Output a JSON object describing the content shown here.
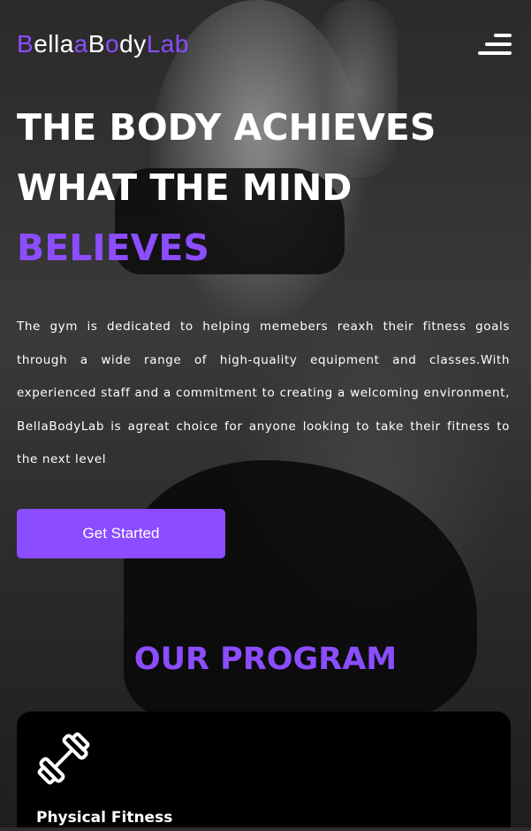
{
  "brand": {
    "logo_parts": [
      {
        "text": "B",
        "accent": true
      },
      {
        "text": "ella",
        "accent": false
      },
      {
        "text": "a",
        "accent": true
      },
      {
        "text": "B",
        "accent": false
      },
      {
        "text": "o",
        "accent": true
      },
      {
        "text": "dy",
        "accent": false
      },
      {
        "text": "Lab",
        "accent": true
      }
    ],
    "menu_icon": "hamburger-menu-icon"
  },
  "hero": {
    "title_line1": "THE BODY ACHIEVES",
    "title_line2": "WHAT THE MIND",
    "title_line3": "BELIEVES",
    "description": "The gym is dedicated to helping memebers reaxh their fitness goals through a wide range of high-quality equipment and classes.With experienced staff and a commitment to creating a welcoming environment, BellaBodyLab is agreat choice for anyone looking to take their fitness to the next level",
    "cta_label": "Get Started"
  },
  "program": {
    "section_title": "OUR PROGRAM",
    "cards": [
      {
        "title": "Physical Fitness",
        "icon": "dumbbell-icon"
      }
    ]
  },
  "colors": {
    "accent": "#8b4dff",
    "text": "#ffffff",
    "card_bg": "#000000"
  }
}
